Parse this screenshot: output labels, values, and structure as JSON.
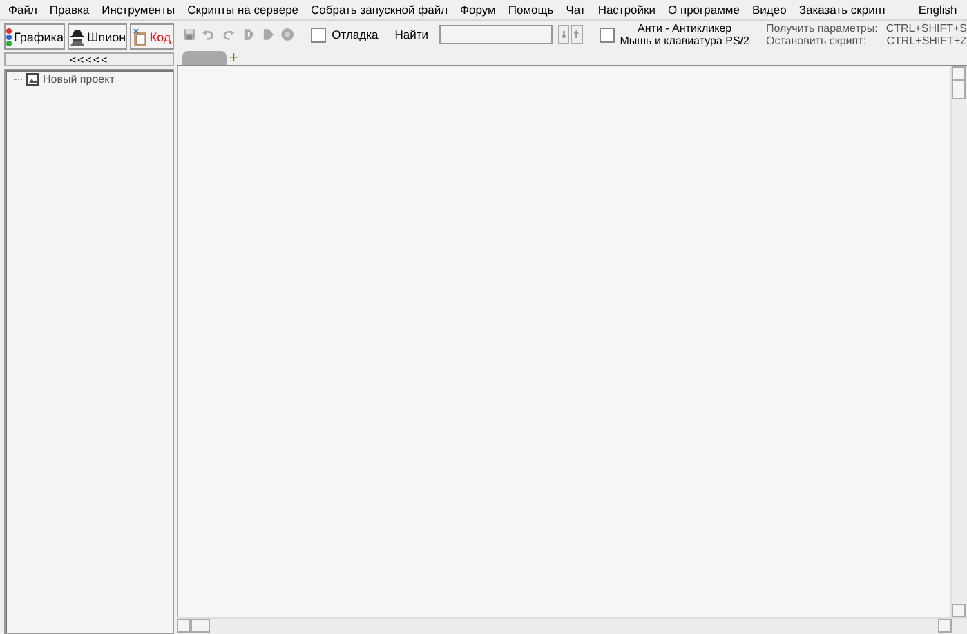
{
  "menu": [
    "Файл",
    "Правка",
    "Инструменты",
    "Скрипты на сервере",
    "Собрать запускной файл",
    "Форум",
    "Помощь",
    "Чат",
    "Настройки",
    "О программе",
    "Видео",
    "Заказать скрипт",
    "English"
  ],
  "mode_buttons": [
    {
      "label": "Графика",
      "color": "#000000"
    },
    {
      "label": "Шпион",
      "color": "#000000"
    },
    {
      "label": "Код",
      "color": "#ff0000"
    }
  ],
  "collapse_button": "<<<<<",
  "tree": [
    {
      "label": "Новый проект"
    }
  ],
  "debug_checkbox": {
    "label": "Отладка",
    "checked": false
  },
  "search": {
    "label": "Найти"
  },
  "anti_clicker": {
    "checked": false,
    "lines": [
      "Анти - Антикликер",
      "Мышь и клавиатура PS/2"
    ]
  },
  "hotkeys": [
    {
      "label": "Получить параметры:",
      "keys": "CTRL+SHIFT+S"
    },
    {
      "label": "Остановить скрипт:",
      "keys": "CTRL+SHIFT+Z"
    }
  ],
  "add_tab": "+"
}
